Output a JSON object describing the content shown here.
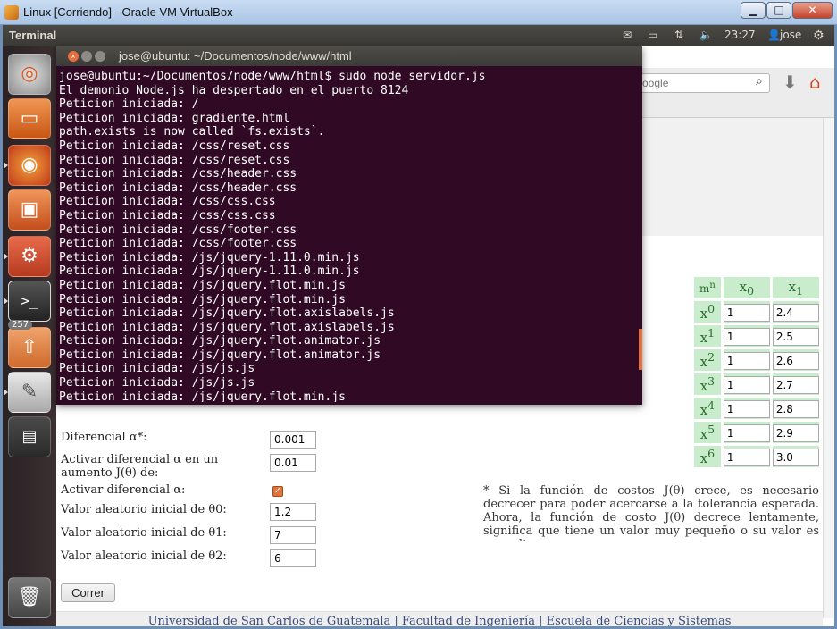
{
  "window": {
    "title": "Linux [Corriendo] - Oracle VM VirtualBox",
    "min_glyph": "▁",
    "max_glyph": "□",
    "close_glyph": "✕"
  },
  "panel": {
    "app_name": "Terminal",
    "mail_icon": "✉",
    "battery_icon": "▭",
    "network_icon": "⇅",
    "volume_icon": "🔈",
    "time": "23:27",
    "user": "jose",
    "user_icon": "👤",
    "settings_icon": "⚙"
  },
  "launcher": {
    "badge": "257"
  },
  "terminal": {
    "title": "jose@ubuntu: ~/Documentos/node/www/html",
    "lines": [
      "jose@ubuntu:~/Documentos/node/www/html$ sudo node servidor.js",
      "El demonio Node.js ha despertado en el puerto 8124",
      "Peticion iniciada: /",
      "Peticion iniciada: gradiente.html",
      "path.exists is now called `fs.exists`.",
      "Peticion iniciada: /css/reset.css",
      "Peticion iniciada: /css/reset.css",
      "Peticion iniciada: /css/header.css",
      "Peticion iniciada: /css/header.css",
      "Peticion iniciada: /css/css.css",
      "Peticion iniciada: /css/css.css",
      "Peticion iniciada: /css/footer.css",
      "Peticion iniciada: /css/footer.css",
      "Peticion iniciada: /js/jquery-1.11.0.min.js",
      "Peticion iniciada: /js/jquery-1.11.0.min.js",
      "Peticion iniciada: /js/jquery.flot.min.js",
      "Peticion iniciada: /js/jquery.flot.min.js",
      "Peticion iniciada: /js/jquery.flot.axislabels.js",
      "Peticion iniciada: /js/jquery.flot.axislabels.js",
      "Peticion iniciada: /js/jquery.flot.animator.js",
      "Peticion iniciada: /js/jquery.flot.animator.js",
      "Peticion iniciada: /js/js.js",
      "Peticion iniciada: /js/js.js",
      "Peticion iniciada: /js/jquery.flot.min.js"
    ]
  },
  "browser": {
    "search_placeholder": "oogle"
  },
  "matrix": {
    "corner": "m n",
    "headers": [
      "x0",
      "x1"
    ],
    "rows": [
      {
        "label": "x0",
        "v0": "1",
        "v1": "2.4"
      },
      {
        "label": "x1",
        "v0": "1",
        "v1": "2.5"
      },
      {
        "label": "x2",
        "v0": "1",
        "v1": "2.6"
      },
      {
        "label": "x3",
        "v0": "1",
        "v1": "2.7"
      },
      {
        "label": "x4",
        "v0": "1",
        "v1": "2.8"
      },
      {
        "label": "x5",
        "v0": "1",
        "v1": "2.9"
      },
      {
        "label": "x6",
        "v0": "1",
        "v1": "3.0"
      }
    ]
  },
  "form": {
    "diff_label": "Diferencial α*:",
    "diff_value": "0.001",
    "aumento_label": "Activar diferencial α en un aumento J(θ) de:",
    "aumento_value": "0.01",
    "activar_label": "Activar diferencial α:",
    "theta0_label": "Valor aleatorio inicial de θ0:",
    "theta0_value": "1.2",
    "theta1_label": "Valor aleatorio inicial de θ1:",
    "theta1_value": "7",
    "theta2_label": "Valor aleatorio inicial de θ2:",
    "theta2_value": "6",
    "run_label": "Correr"
  },
  "note": "* Si la función de costos J(θ) crece, es necesario decrecer para poder acercarse a la tolerancia esperada. Ahora, la función de costo J(θ) decrece lentamente, significa que tiene un valor muy pequeño o su valor es muy alto.",
  "footer": "Universidad de San Carlos de Guatemala | Facultad de Ingeniería | Escuela de Ciencias y Sistemas"
}
